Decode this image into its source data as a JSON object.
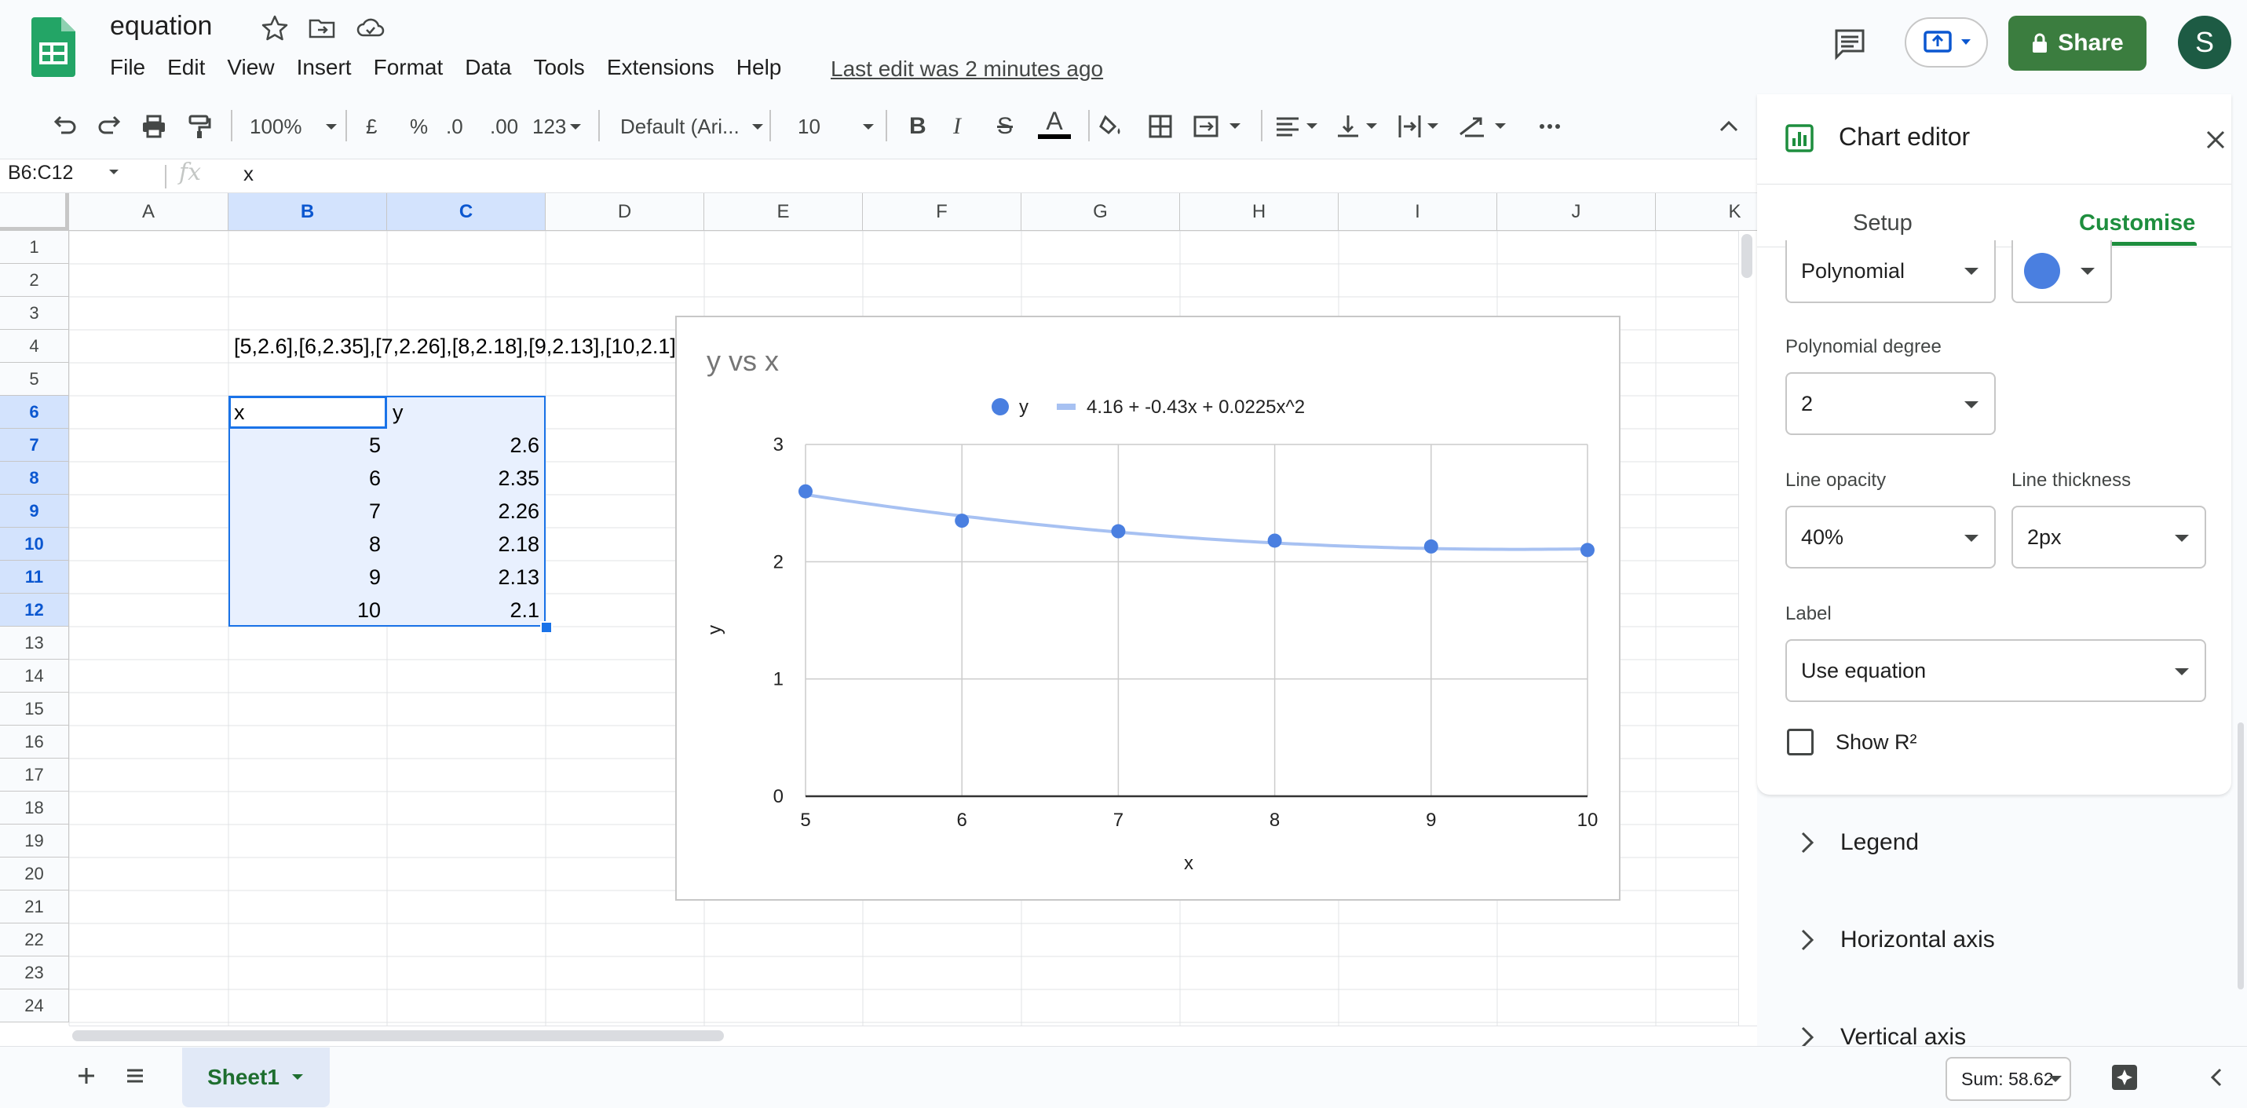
{
  "app": {
    "doc_title": "equation",
    "last_edit": "Last edit was 2 minutes ago",
    "share_label": "Share",
    "avatar_letter": "S"
  },
  "menu": [
    "File",
    "Edit",
    "View",
    "Insert",
    "Format",
    "Data",
    "Tools",
    "Extensions",
    "Help"
  ],
  "toolbar": {
    "zoom": "100%",
    "currency": "£",
    "percent": "%",
    "dec_less": ".0",
    "dec_more": ".00",
    "number_format": "123",
    "font": "Default (Ari...",
    "font_size": "10",
    "bold": "B",
    "italic": "I",
    "strike": "S",
    "text_color": "A"
  },
  "formula_bar": {
    "name_box": "B6:C12",
    "fx": "fx",
    "content": "x"
  },
  "grid": {
    "columns": [
      "A",
      "B",
      "C",
      "D",
      "E",
      "F",
      "G",
      "H",
      "I",
      "J",
      "K"
    ],
    "rows": [
      "1",
      "2",
      "3",
      "4",
      "5",
      "6",
      "7",
      "8",
      "9",
      "10",
      "11",
      "12",
      "13",
      "14",
      "15",
      "16",
      "17",
      "18",
      "19",
      "20",
      "21",
      "22",
      "23",
      "24"
    ],
    "note_cell": "[5,2.6],[6,2.35],[7,2.26],[8,2.18],[9,2.13],[10,2.1]",
    "header_x": "x",
    "header_y": "y",
    "table": [
      {
        "x": "5",
        "y": "2.6"
      },
      {
        "x": "6",
        "y": "2.35"
      },
      {
        "x": "7",
        "y": "2.26"
      },
      {
        "x": "8",
        "y": "2.18"
      },
      {
        "x": "9",
        "y": "2.13"
      },
      {
        "x": "10",
        "y": "2.1"
      }
    ]
  },
  "chart_data": {
    "type": "scatter",
    "title": "y vs x",
    "xlabel": "x",
    "ylabel": "y",
    "x": [
      5,
      6,
      7,
      8,
      9,
      10
    ],
    "series": [
      {
        "name": "y",
        "values": [
          2.6,
          2.35,
          2.26,
          2.18,
          2.13,
          2.1
        ],
        "color": "#4a7fe0"
      },
      {
        "name": "4.16 + -0.43x + 0.0225x^2",
        "trendline": "polynomial",
        "coefficients": [
          4.16,
          -0.43,
          0.0225
        ],
        "color": "#a7c1f2"
      }
    ],
    "xlim": [
      5,
      10
    ],
    "ylim": [
      0,
      3
    ],
    "xticks": [
      "5",
      "6",
      "7",
      "8",
      "9",
      "10"
    ],
    "yticks": [
      "0",
      "1",
      "2",
      "3"
    ],
    "grid": true,
    "legend": "top"
  },
  "editor": {
    "title": "Chart editor",
    "tab_setup": "Setup",
    "tab_customise": "Customise",
    "trendline_type": "Polynomial",
    "trendline_color": "#4a7fe0",
    "poly_degree_label": "Polynomial degree",
    "poly_degree": "2",
    "opacity_label": "Line opacity",
    "opacity": "40%",
    "thickness_label": "Line thickness",
    "thickness": "2px",
    "label_label": "Label",
    "label_value": "Use equation",
    "show_r2": "Show R²",
    "sections": [
      "Legend",
      "Horizontal axis",
      "Vertical axis"
    ]
  },
  "bottom": {
    "sheet_name": "Sheet1",
    "sum": "Sum: 58.62"
  },
  "colors": {
    "green": "#1e8e3e",
    "accent": "#0b57d0",
    "selection": "#e8f0fe"
  }
}
